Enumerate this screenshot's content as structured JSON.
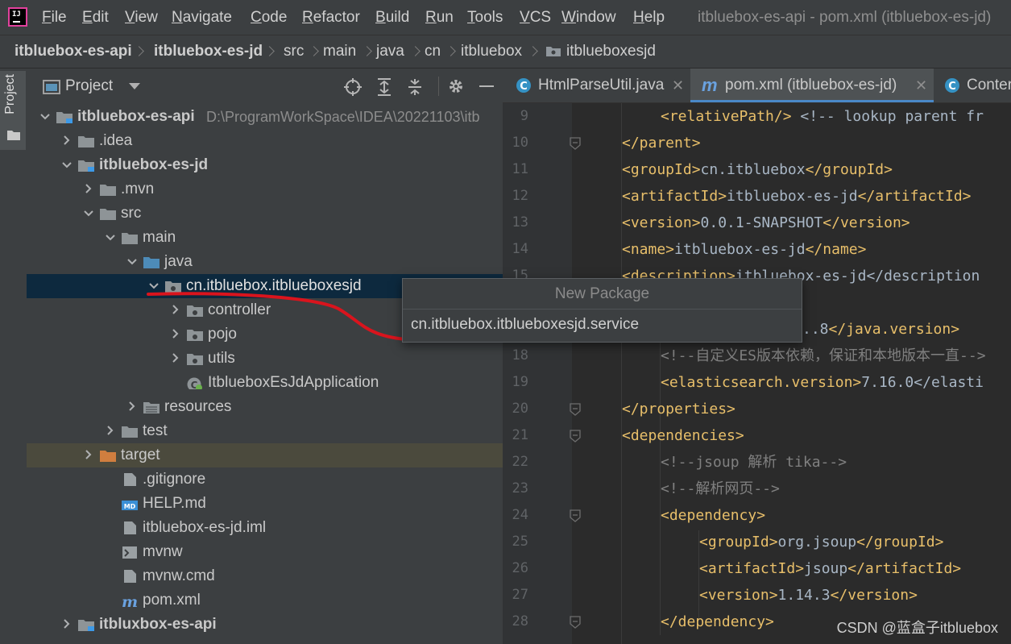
{
  "app": {
    "window_title": "itbluebox-es-api - pom.xml (itbluebox-es-jd)"
  },
  "menu": [
    "File",
    "Edit",
    "View",
    "Navigate",
    "Code",
    "Refactor",
    "Build",
    "Run",
    "Tools",
    "VCS",
    "Window",
    "Help"
  ],
  "breadcrumb": [
    "itbluebox-es-api",
    "itbluebox-es-jd",
    "src",
    "main",
    "java",
    "cn",
    "itbluebox",
    "itblueboxesjd"
  ],
  "tool_stripe": {
    "project_label": "Project"
  },
  "project_panel": {
    "title": "Project",
    "tree": [
      {
        "label": "itbluebox-es-api",
        "hint": "D:\\ProgramWorkSpace\\IDEA\\20221103\\itb",
        "bold": true
      },
      {
        "label": ".idea"
      },
      {
        "label": "itbluebox-es-jd",
        "bold": true
      },
      {
        "label": ".mvn"
      },
      {
        "label": "src"
      },
      {
        "label": "main"
      },
      {
        "label": "java"
      },
      {
        "label": "cn.itbluebox.itblueboxesjd"
      },
      {
        "label": "controller"
      },
      {
        "label": "pojo"
      },
      {
        "label": "utils"
      },
      {
        "label": "ItblueboxEsJdApplication"
      },
      {
        "label": "resources"
      },
      {
        "label": "test"
      },
      {
        "label": "target"
      },
      {
        "label": ".gitignore"
      },
      {
        "label": "HELP.md"
      },
      {
        "label": "itbluebox-es-jd.iml"
      },
      {
        "label": "mvnw"
      },
      {
        "label": "mvnw.cmd"
      },
      {
        "label": "pom.xml"
      },
      {
        "label": "itbluxbox-es-api",
        "bold": true
      }
    ]
  },
  "tabs": [
    {
      "label": "HtmlParseUtil.java"
    },
    {
      "label": "pom.xml (itbluebox-es-jd)",
      "active": true
    },
    {
      "label": "Conter"
    }
  ],
  "editor": {
    "lines": [
      {
        "n": "9",
        "text": "<relativePath/> <!-- lookup parent fr"
      },
      {
        "n": "10",
        "text": "</parent>"
      },
      {
        "n": "11",
        "text": "<groupId>cn.itbluebox</groupId>"
      },
      {
        "n": "12",
        "text": "<artifactId>itbluebox-es-jd</artifactId>"
      },
      {
        "n": "13",
        "text": "<version>0.0.1-SNAPSHOT</version>"
      },
      {
        "n": "14",
        "text": "<name>itbluebox-es-jd</name>"
      },
      {
        "n": "15",
        "text": "<description>itbluebox-es-jd</description"
      },
      {
        "n": "16",
        "text": ""
      },
      {
        "n": "17",
        "text": "..8</java.version>"
      },
      {
        "n": "18",
        "text": "<!--自定义ES版本依赖，保证和本地版本一直-->"
      },
      {
        "n": "19",
        "text": "<elasticsearch.version>7.16.0</elasti"
      },
      {
        "n": "20",
        "text": "</properties>"
      },
      {
        "n": "21",
        "text": "<dependencies>"
      },
      {
        "n": "22",
        "text": "<!--jsoup 解析 tika-->"
      },
      {
        "n": "23",
        "text": "<!--解析网页-->"
      },
      {
        "n": "24",
        "text": "<dependency>"
      },
      {
        "n": "25",
        "text": "<groupId>org.jsoup</groupId>"
      },
      {
        "n": "26",
        "text": "<artifactId>jsoup</artifactId>"
      },
      {
        "n": "27",
        "text": "<version>1.14.3</version>"
      },
      {
        "n": "28",
        "text": "</dependency>"
      }
    ]
  },
  "popup": {
    "title": "New Package",
    "value": "cn.itbluebox.itblueboxesjd.service"
  },
  "watermark": "CSDN @蓝盒子itbluebox",
  "colors": {
    "accent_red": "#d9141d",
    "selection": "#0d293e",
    "tag": "#e8bf6a",
    "comment": "#808080"
  }
}
